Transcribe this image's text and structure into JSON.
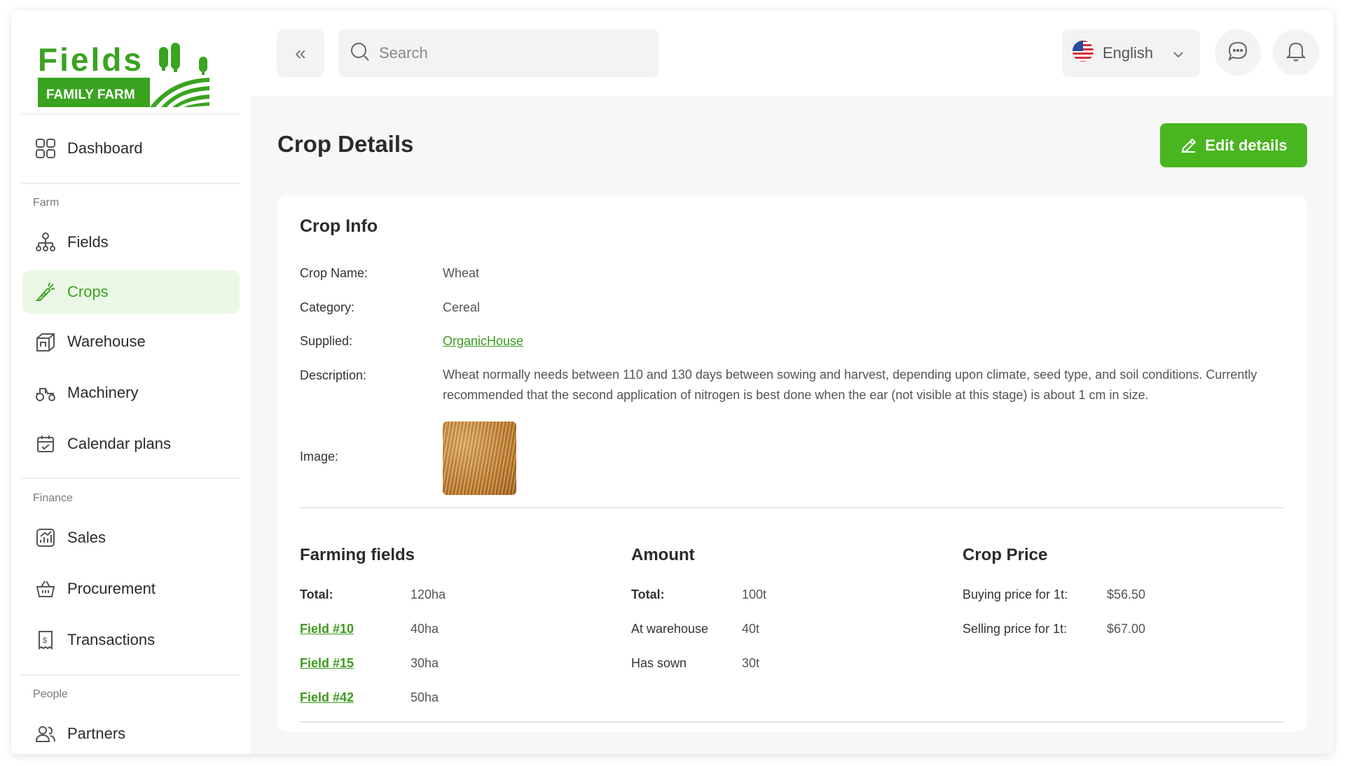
{
  "brand": {
    "name": "Fields",
    "tagline": "FAMILY FARM",
    "green": "#3aa320",
    "accent": "#49b51f"
  },
  "sidebar": {
    "dashboard": {
      "label": "Dashboard",
      "icon": "grid-icon"
    },
    "sections": [
      {
        "label": "Farm",
        "items": [
          {
            "label": "Fields",
            "icon": "fields-icon"
          },
          {
            "label": "Crops",
            "icon": "carrot-icon",
            "active": true
          },
          {
            "label": "Warehouse",
            "icon": "warehouse-icon"
          },
          {
            "label": "Machinery",
            "icon": "tractor-icon"
          },
          {
            "label": "Calendar plans",
            "icon": "calendar-icon"
          }
        ]
      },
      {
        "label": "Finance",
        "items": [
          {
            "label": "Sales",
            "icon": "chart-icon"
          },
          {
            "label": "Procurement",
            "icon": "basket-icon"
          },
          {
            "label": "Transactions",
            "icon": "receipt-icon"
          }
        ]
      },
      {
        "label": "People",
        "items": [
          {
            "label": "Partners",
            "icon": "people-icon"
          }
        ]
      }
    ]
  },
  "topbar": {
    "collapse_glyph": "«",
    "search_placeholder": "Search",
    "language": "English"
  },
  "page": {
    "title": "Crop Details",
    "edit_label": "Edit details"
  },
  "crop_info": {
    "title": "Crop Info",
    "fields": [
      {
        "label": "Crop Name:",
        "value": "Wheat"
      },
      {
        "label": "Category:",
        "value": "Cereal"
      },
      {
        "label": "Supplied:",
        "value": "OrganicHouse"
      }
    ],
    "description_label": "Description:",
    "description": "Wheat normally needs between 110 and 130 days between sowing and harvest, depending upon climate, seed type, and soil conditions. Currently recommended that the second application of nitrogen is best  done when the ear (not visible at this stage) is about 1 cm in size.",
    "image_label": "Image:"
  },
  "farming_fields": {
    "title": "Farming fields",
    "rows": [
      {
        "label": "Total:",
        "value": "120ha"
      },
      {
        "label": "Field #10",
        "value": "40ha"
      },
      {
        "label": "Field #15",
        "value": "30ha"
      },
      {
        "label": "Field #42",
        "value": "50ha"
      }
    ]
  },
  "amount": {
    "title": "Amount",
    "rows": [
      {
        "label": "Total:",
        "value": "100t"
      },
      {
        "label": "At warehouse",
        "value": "40t"
      },
      {
        "label": "Has sown",
        "value": "30t"
      }
    ]
  },
  "crop_price": {
    "title": "Crop Price",
    "rows": [
      {
        "label": "Buying price for 1t:",
        "value": "$56.50"
      },
      {
        "label": "Selling price for 1t:",
        "value": "$67.00"
      }
    ]
  }
}
